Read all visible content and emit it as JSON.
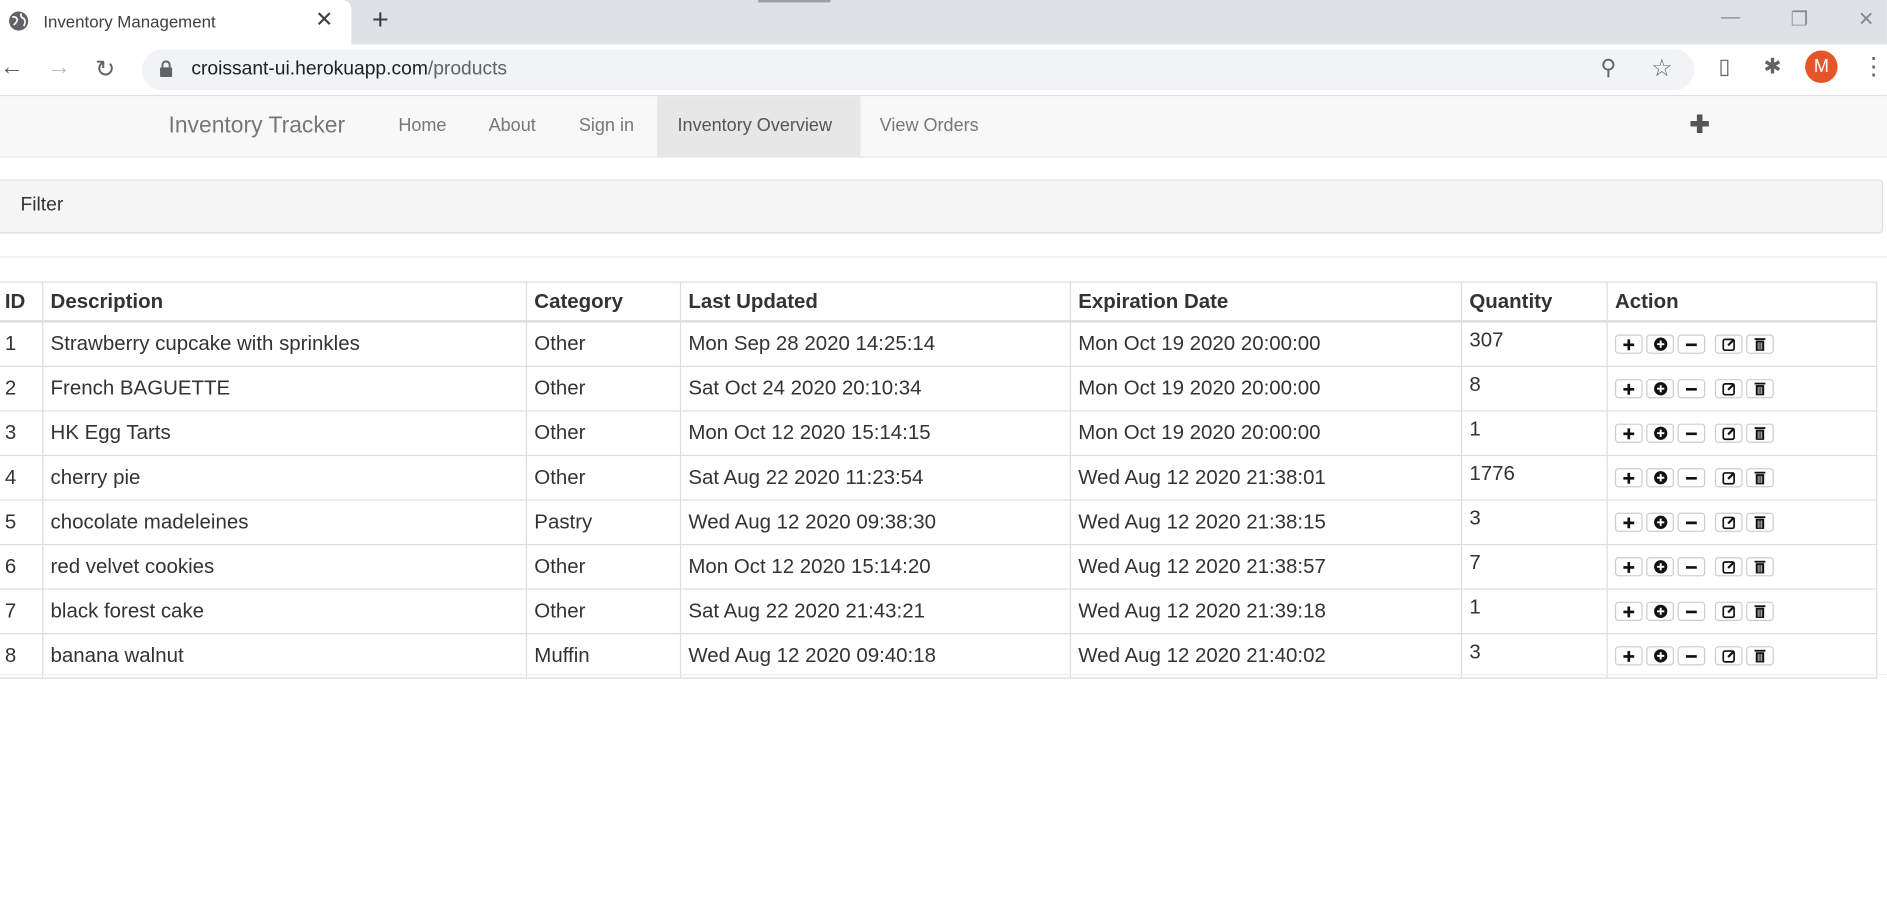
{
  "browser": {
    "tab_title": "Inventory Management",
    "url_host": "croissant-ui.herokuapp.com",
    "url_path": "/products",
    "avatar_initial": "M"
  },
  "navbar": {
    "brand": "Inventory Tracker",
    "items": [
      {
        "label": "Home",
        "active": false
      },
      {
        "label": "About",
        "active": false
      },
      {
        "label": "Sign in",
        "active": false
      },
      {
        "label": "Inventory Overview",
        "active": true
      },
      {
        "label": "View Orders",
        "active": false
      }
    ],
    "add_icon": "plus-icon"
  },
  "filter": {
    "label": "Filter"
  },
  "table": {
    "headers": [
      "ID",
      "Description",
      "Category",
      "Last Updated",
      "Expiration Date",
      "Quantity",
      "Action"
    ],
    "rows": [
      [
        "1",
        "Strawberry cupcake with sprinkles",
        "Other",
        "Mon Sep 28 2020 14:25:14",
        "Mon Oct 19 2020 20:00:00",
        "307"
      ],
      [
        "2",
        "French BAGUETTE",
        "Other",
        "Sat Oct 24 2020 20:10:34",
        "Mon Oct 19 2020 20:00:00",
        "8"
      ],
      [
        "3",
        "HK Egg Tarts",
        "Other",
        "Mon Oct 12 2020 15:14:15",
        "Mon Oct 19 2020 20:00:00",
        "1"
      ],
      [
        "4",
        "cherry pie",
        "Other",
        "Sat Aug 22 2020 11:23:54",
        "Wed Aug 12 2020 21:38:01",
        "1776"
      ],
      [
        "5",
        "chocolate madeleines",
        "Pastry",
        "Wed Aug 12 2020 09:38:30",
        "Wed Aug 12 2020 21:38:15",
        "3"
      ],
      [
        "6",
        "red velvet cookies",
        "Other",
        "Mon Oct 12 2020 15:14:20",
        "Wed Aug 12 2020 21:38:57",
        "7"
      ],
      [
        "7",
        "black forest cake",
        "Other",
        "Sat Aug 22 2020 21:43:21",
        "Wed Aug 12 2020 21:39:18",
        "1"
      ],
      [
        "8",
        "banana walnut",
        "Muffin",
        "Wed Aug 12 2020 09:40:18",
        "Wed Aug 12 2020 21:40:02",
        "3"
      ]
    ],
    "action_icons": [
      "plus-icon",
      "plus-circle-icon",
      "minus-icon",
      "edit-icon",
      "trash-icon"
    ]
  }
}
